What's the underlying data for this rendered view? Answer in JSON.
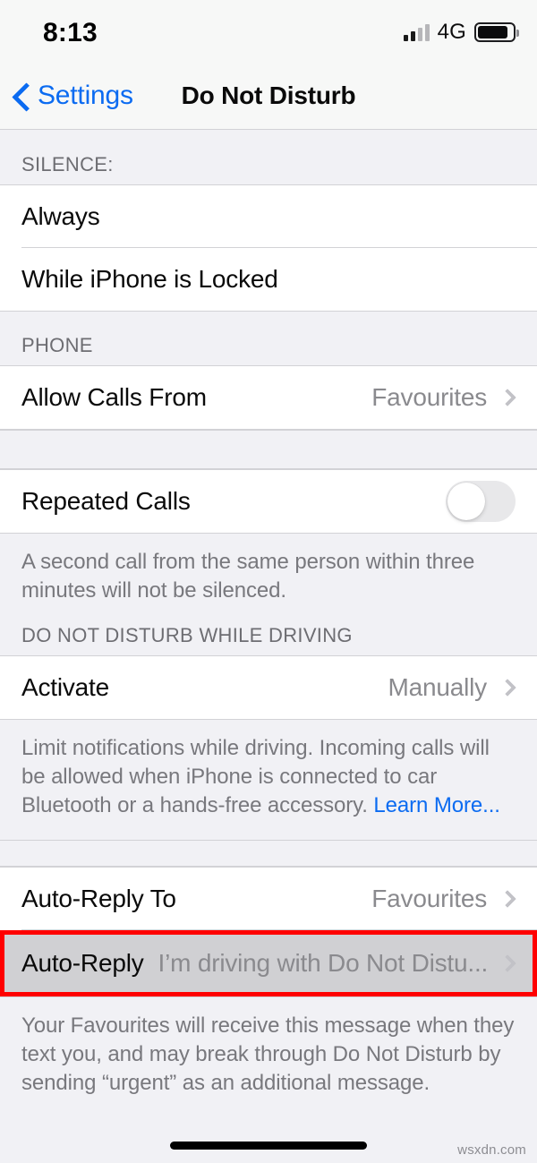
{
  "status_bar": {
    "time": "8:13",
    "network": "4G",
    "signal_icon": "signal-bars-icon",
    "battery_icon": "battery-icon"
  },
  "nav": {
    "back_label": "Settings",
    "back_icon": "chevron-left-icon",
    "title": "Do Not Disturb"
  },
  "sections": {
    "silence": {
      "header": "SILENCE:",
      "rows": [
        {
          "label": "Always"
        },
        {
          "label": "While iPhone is Locked"
        }
      ]
    },
    "phone": {
      "header": "PHONE",
      "rows": [
        {
          "label": "Allow Calls From",
          "value": "Favourites",
          "icon": "chevron-right-icon"
        }
      ]
    },
    "repeated_calls": {
      "label": "Repeated Calls",
      "toggle_state": "off",
      "footnote": "A second call from the same person within three minutes will not be silenced."
    },
    "driving": {
      "header": "DO NOT DISTURB WHILE DRIVING",
      "activate": {
        "label": "Activate",
        "value": "Manually",
        "icon": "chevron-right-icon"
      },
      "footnote_text": "Limit notifications while driving. Incoming calls will be allowed when iPhone is connected to car Bluetooth or a hands-free accessory. ",
      "footnote_link": "Learn More..."
    },
    "auto_reply": {
      "to_row": {
        "label": "Auto-Reply To",
        "value": "Favourites",
        "icon": "chevron-right-icon"
      },
      "message_row": {
        "label": "Auto-Reply",
        "value": "I’m driving with Do Not Distu...",
        "icon": "chevron-right-icon",
        "highlighted": true
      },
      "footnote": "Your Favourites will receive this message when they text you, and may break through Do Not Disturb by sending “urgent” as an additional message."
    }
  },
  "annotation": {
    "color": "#ff0000"
  },
  "watermark": "wsxdn.com",
  "colors": {
    "accent_blue": "#0b6bf1",
    "page_bg": "#f1f1f5",
    "row_bg": "#ffffff",
    "pressed_bg": "#d0d0d3",
    "separator": "#d2d2d6",
    "secondary_text": "#8a8a8e"
  }
}
